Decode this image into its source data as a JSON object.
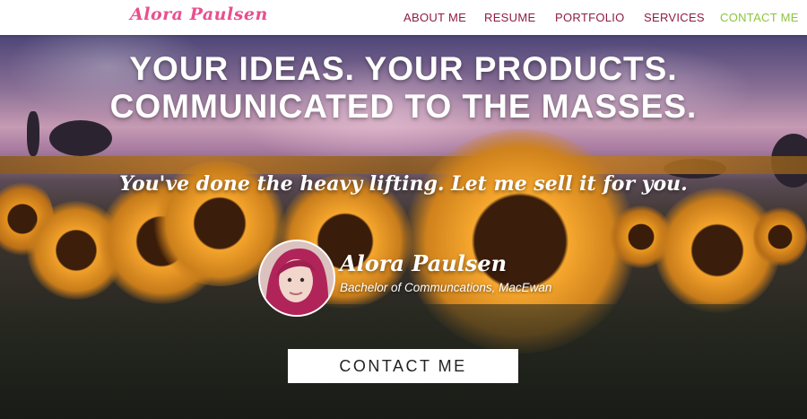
{
  "brand": {
    "name": "Alora Paulsen"
  },
  "nav": {
    "items": [
      {
        "label": "ABOUT ME",
        "active": false
      },
      {
        "label": "RESUME",
        "active": false
      },
      {
        "label": "PORTFOLIO",
        "active": false
      },
      {
        "label": "SERVICES",
        "active": false
      },
      {
        "label": "CONTACT ME",
        "active": true
      }
    ]
  },
  "hero": {
    "headline_line1": "YOUR IDEAS. YOUR PRODUCTS.",
    "headline_line2": "COMMUNICATED TO THE MASSES.",
    "tagline": "You've done the heavy lifting. Let me sell it for you.",
    "profile": {
      "name": "Alora Paulsen",
      "credential": "Bachelor of Communcations, MacEwan"
    },
    "cta_label": "CONTACT ME"
  },
  "colors": {
    "brand_pink": "#e94f8e",
    "nav_text": "#8e1d3f",
    "nav_active": "#8bc53f",
    "cta_background": "#ffffff",
    "cta_text": "#222222"
  }
}
